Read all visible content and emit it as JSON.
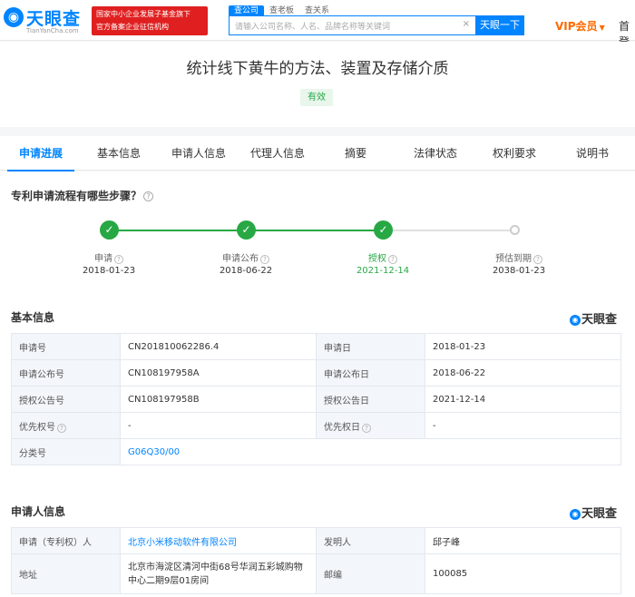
{
  "header": {
    "logo_text": "天眼查",
    "logo_domain": "TianYanCha.com",
    "badge_line1": "国家中小企业发展子基金旗下",
    "badge_line2": "官方备案企业征信机构",
    "search_tabs": [
      "查公司",
      "查老板",
      "查关系"
    ],
    "search_placeholder": "请输入公司名称、人名、品牌名称等关键词",
    "search_button": "天眼一下",
    "vip_label": "VIP会员",
    "cut_link": "首登"
  },
  "patent": {
    "title": "统计线下黄牛的方法、装置及存储介质",
    "status": "有效"
  },
  "tabs": [
    "申请进展",
    "基本信息",
    "申请人信息",
    "代理人信息",
    "摘要",
    "法律状态",
    "权利要求",
    "说明书"
  ],
  "progress": {
    "question": "专利申请流程有哪些步骤？",
    "steps": [
      {
        "name": "申请",
        "date": "2018-01-23",
        "done": true
      },
      {
        "name": "申请公布",
        "date": "2018-06-22",
        "done": true
      },
      {
        "name": "授权",
        "date": "2021-12-14",
        "done": true
      },
      {
        "name": "预估到期",
        "date": "2038-01-23",
        "done": false
      }
    ]
  },
  "basic": {
    "title": "基本信息",
    "brand": "天眼查",
    "rows": [
      [
        "申请号",
        "CN201810062286.4",
        "申请日",
        "2018-01-23"
      ],
      [
        "申请公布号",
        "CN108197958A",
        "申请公布日",
        "2018-06-22"
      ],
      [
        "授权公告号",
        "CN108197958B",
        "授权公告日",
        "2021-12-14"
      ],
      [
        "优先权号",
        "-",
        "优先权日",
        "-"
      ]
    ],
    "class_label": "分类号",
    "class_value": "G06Q30/00"
  },
  "applicant": {
    "title": "申请人信息",
    "brand": "天眼查",
    "applicant_label": "申请（专利权）人",
    "applicant_value": "北京小米移动软件有限公司",
    "inventor_label": "发明人",
    "inventor_value": "邱子峰",
    "address_label": "地址",
    "address_line1": "北京市海淀区清河中街68号华润五彩城购物",
    "address_line2": "中心二期9层01房间",
    "zip_label": "邮编",
    "zip_value": "100085"
  },
  "colors": {
    "brand": "#0084ff",
    "green": "#27a844",
    "red": "#e02020",
    "vip": "#ff6a00"
  }
}
